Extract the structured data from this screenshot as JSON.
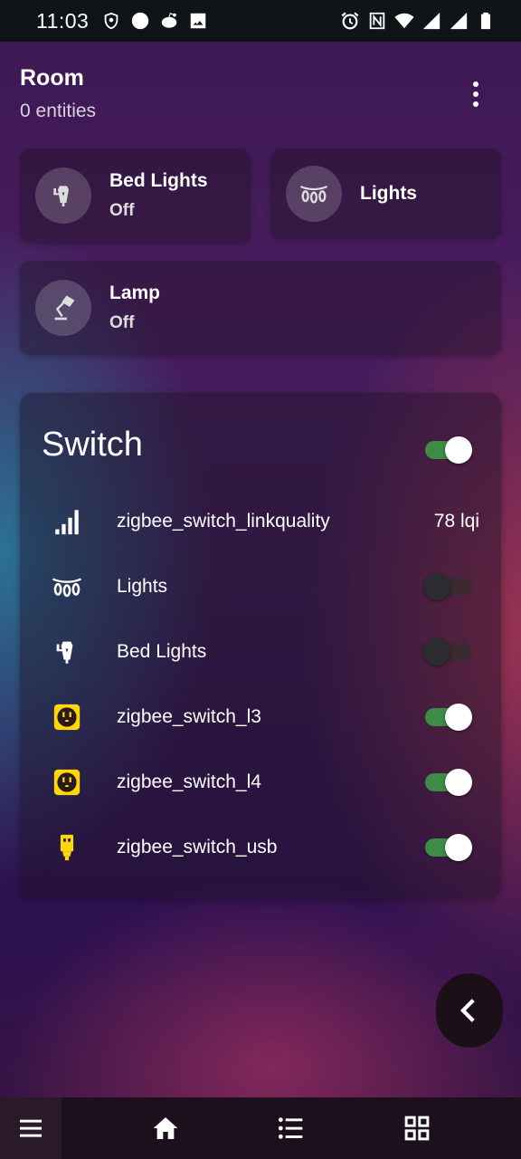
{
  "status_bar": {
    "time": "11:03",
    "left_icons": [
      "shield-icon",
      "circle-icon",
      "reddit-icon",
      "image-icon"
    ],
    "right_icons": [
      "alarm-icon",
      "nfc-icon",
      "wifi-icon",
      "signal-icon",
      "signal-icon",
      "battery-icon"
    ]
  },
  "header": {
    "title": "Room",
    "subtitle": "0 entities",
    "menu_icon": "more-vert-icon"
  },
  "tiles": [
    {
      "name": "Bed Lights",
      "state": "Off",
      "icon": "outdoor-lamp-icon"
    },
    {
      "name": "Lights",
      "state": "",
      "icon": "string-lights-icon"
    },
    {
      "name": "Lamp",
      "state": "Off",
      "icon": "desk-lamp-icon"
    }
  ],
  "switch_card": {
    "title": "Switch",
    "master_toggle_on": true,
    "rows": [
      {
        "name": "zigbee_switch_linkquality",
        "value": "78 lqi",
        "icon": "signal-bars-icon",
        "icon_color": "#ffffff"
      },
      {
        "name": "Lights",
        "toggle_on": false,
        "icon": "string-lights-icon",
        "icon_color": "#ffffff"
      },
      {
        "name": "Bed Lights",
        "toggle_on": false,
        "icon": "outdoor-lamp-icon",
        "icon_color": "#ffffff"
      },
      {
        "name": "zigbee_switch_l3",
        "toggle_on": true,
        "icon": "power-socket-icon",
        "icon_color": "#ffd60a"
      },
      {
        "name": "zigbee_switch_l4",
        "toggle_on": true,
        "icon": "power-socket-icon",
        "icon_color": "#ffd60a"
      },
      {
        "name": "zigbee_switch_usb",
        "toggle_on": true,
        "icon": "usb-plug-icon",
        "icon_color": "#ffd60a"
      }
    ]
  },
  "fab": {
    "icon": "chevron-left-icon"
  },
  "bottom_nav": {
    "items": [
      "menu-icon",
      "home-icon",
      "list-icon",
      "grid-icon"
    ]
  },
  "colors": {
    "toggle_on": "#3d8b45",
    "accent_yellow": "#ffd60a",
    "status_bar": "#0f1517",
    "bottom_nav": "#1d0f1c"
  }
}
